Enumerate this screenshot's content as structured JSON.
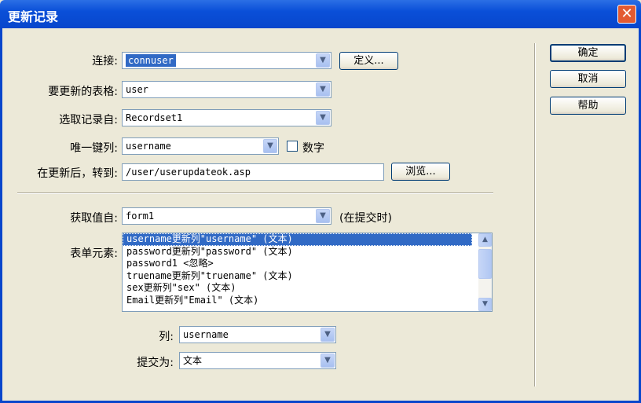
{
  "window": {
    "title": "更新记录",
    "close_glyph": "✕"
  },
  "connection": {
    "label": "连接:",
    "value": "connuser",
    "define_button": "定义..."
  },
  "table": {
    "label": "要更新的表格:",
    "value": "user"
  },
  "recordset": {
    "label": "选取记录自:",
    "value": "Recordset1"
  },
  "unique_key": {
    "label": "唯一键列:",
    "value": "username",
    "numeric_label": "数字",
    "numeric_checked": false
  },
  "redirect": {
    "label": "在更新后，转到:",
    "value": "/user/userupdateok.asp",
    "browse_button": "浏览..."
  },
  "get_values": {
    "label": "获取值自:",
    "value": "form1",
    "note": "(在提交时)"
  },
  "form_elements": {
    "label": "表单元素:",
    "items": [
      "username更新列\"username\" (文本)",
      "password更新列\"password\" (文本)",
      "password1 <忽略>",
      "truename更新列\"truename\" (文本)",
      "sex更新列\"sex\" (文本)",
      "Email更新列\"Email\" (文本)"
    ],
    "selected_index": 0
  },
  "column": {
    "label": "列:",
    "value": "username"
  },
  "submit_as": {
    "label": "提交为:",
    "value": "文本"
  },
  "buttons": {
    "ok": "确定",
    "cancel": "取消",
    "help": "帮助"
  }
}
